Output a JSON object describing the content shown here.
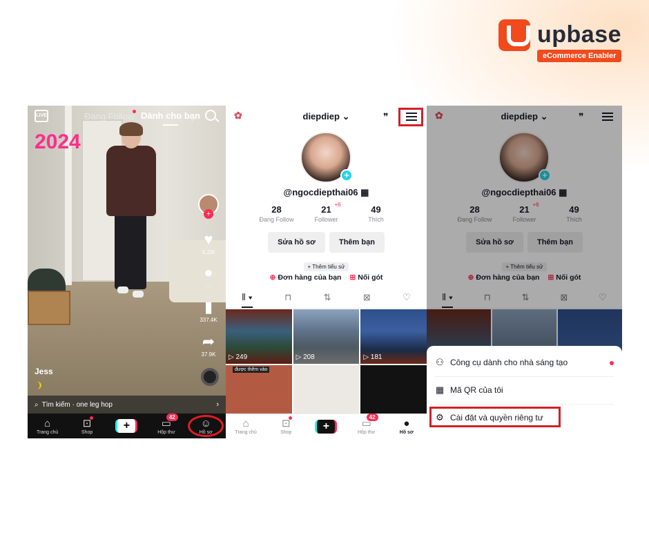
{
  "logo": {
    "name": "upbase",
    "tagline": "eCommerce Enabler"
  },
  "panel1": {
    "live": "LIVE",
    "tab_following": "Đang Follow",
    "tab_foryou": "Dành cho bạn",
    "sticker": "2024",
    "likes": "5.2M",
    "comments": "...",
    "saves": "337.4K",
    "shares": "37.9K",
    "author": "Jess",
    "search_label": "Tìm kiếm · one leg hop",
    "nav": [
      {
        "label": "Trang chủ",
        "icon": "home-icon"
      },
      {
        "label": "Shop",
        "icon": "shop-icon"
      },
      {
        "label": "",
        "icon": "plus-icon"
      },
      {
        "label": "Hộp thư",
        "icon": "inbox-icon",
        "badge": "42"
      },
      {
        "label": "Hồ sơ",
        "icon": "profile-icon"
      }
    ]
  },
  "profile": {
    "username": "diepdiep",
    "handle": "@ngocdiepthai06",
    "stats": [
      {
        "num": "28",
        "label": "Đang Follow"
      },
      {
        "num": "21",
        "label": "Follower",
        "plus": "+6"
      },
      {
        "num": "49",
        "label": "Thích"
      }
    ],
    "edit_btn": "Sửa hồ sơ",
    "add_friend_btn": "Thêm bạn",
    "bio_btn": "+ Thêm tiểu sử",
    "orders": "Đơn hàng của bạn",
    "heel": "Nối gót",
    "views": [
      "249",
      "208",
      "181"
    ],
    "caption": "được thêm vào",
    "nav": [
      {
        "label": "Trang chủ",
        "icon": "home-icon"
      },
      {
        "label": "Shop",
        "icon": "shop-icon"
      },
      {
        "label": "",
        "icon": "plus-icon"
      },
      {
        "label": "Hộp thư",
        "icon": "inbox-icon",
        "badge": "42"
      },
      {
        "label": "Hồ sơ",
        "icon": "profile-icon"
      }
    ]
  },
  "menu": {
    "creator_tools": "Công cụ dành cho nhà sáng tạo",
    "my_qr": "Mã QR của tôi",
    "settings": "Cài đặt và quyền riêng tư"
  }
}
